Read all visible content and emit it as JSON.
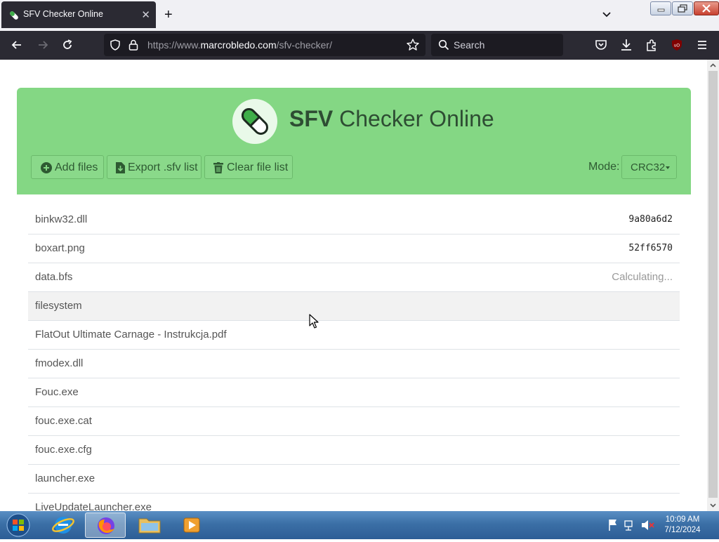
{
  "browser": {
    "tab_title": "SFV Checker Online",
    "url_prefix": "https://www.",
    "url_domain": "marcrobledo.com",
    "url_path": "/sfv-checker/",
    "search_placeholder": "Search"
  },
  "app": {
    "title_bold": "SFV",
    "title_rest": " Checker Online",
    "add_files": "Add files",
    "export_sfv": "Export .sfv list",
    "clear_list": "Clear file list",
    "mode_label": "Mode:",
    "mode_value": "CRC32",
    "accent_color": "#84d784"
  },
  "files": [
    {
      "name": "binkw32.dll",
      "crc": "9a80a6d2",
      "status": ""
    },
    {
      "name": "boxart.png",
      "crc": "52ff6570",
      "status": ""
    },
    {
      "name": "data.bfs",
      "crc": "",
      "status": "Calculating..."
    },
    {
      "name": "filesystem",
      "crc": "",
      "status": ""
    },
    {
      "name": "FlatOut Ultimate Carnage - Instrukcja.pdf",
      "crc": "",
      "status": ""
    },
    {
      "name": "fmodex.dll",
      "crc": "",
      "status": ""
    },
    {
      "name": "Fouc.exe",
      "crc": "",
      "status": ""
    },
    {
      "name": "fouc.exe.cat",
      "crc": "",
      "status": ""
    },
    {
      "name": "fouc.exe.cfg",
      "crc": "",
      "status": ""
    },
    {
      "name": "launcher.exe",
      "crc": "",
      "status": ""
    },
    {
      "name": "LiveUpdateLauncher.exe",
      "crc": "",
      "status": ""
    }
  ],
  "taskbar": {
    "time": "10:09 AM",
    "date": "7/12/2024"
  }
}
